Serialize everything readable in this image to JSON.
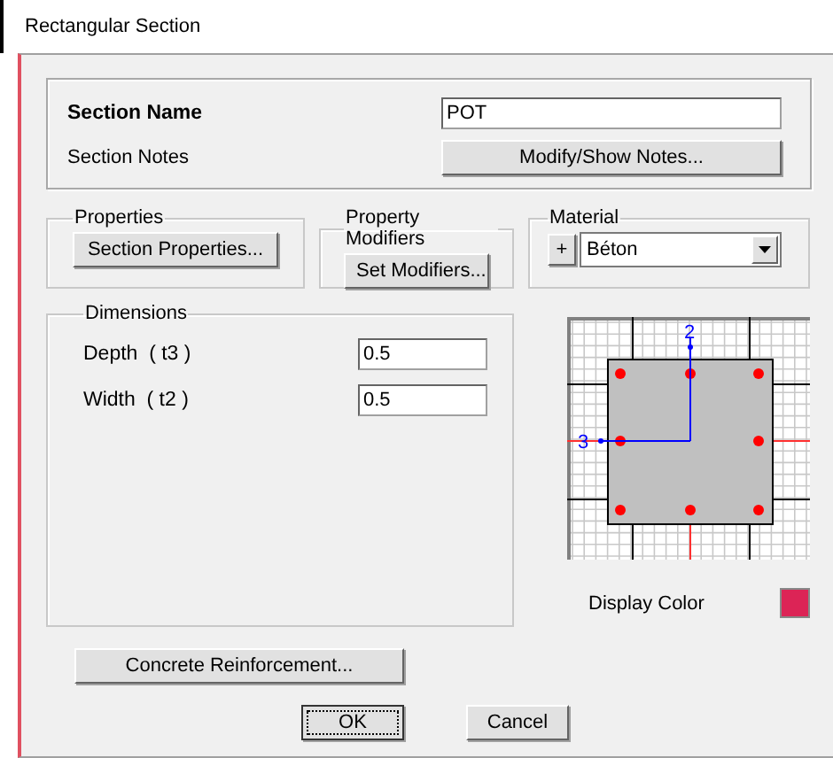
{
  "window": {
    "title": "Rectangular Section"
  },
  "section": {
    "name_label": "Section Name",
    "name_value": "POT",
    "notes_label": "Section Notes",
    "notes_button": "Modify/Show Notes..."
  },
  "properties": {
    "title": "Properties",
    "button": "Section Properties..."
  },
  "property_modifiers": {
    "title": "Property Modifiers",
    "button": "Set Modifiers..."
  },
  "material": {
    "title": "Material",
    "add_button": "+",
    "value": "Béton"
  },
  "dimensions": {
    "title": "Dimensions",
    "fields": [
      {
        "label": "Depth  ( t3 )",
        "value": "0.5"
      },
      {
        "label": "Width  ( t2 )",
        "value": "0.5"
      }
    ]
  },
  "diagram": {
    "axis_labels": [
      "2",
      "3"
    ]
  },
  "display_color": {
    "label": "Display Color",
    "color": "#dc2456"
  },
  "reinforcement_button": "Concrete Reinforcement...",
  "buttons": [
    {
      "label": "OK",
      "focused": true
    },
    {
      "label": "Cancel",
      "focused": false
    }
  ]
}
